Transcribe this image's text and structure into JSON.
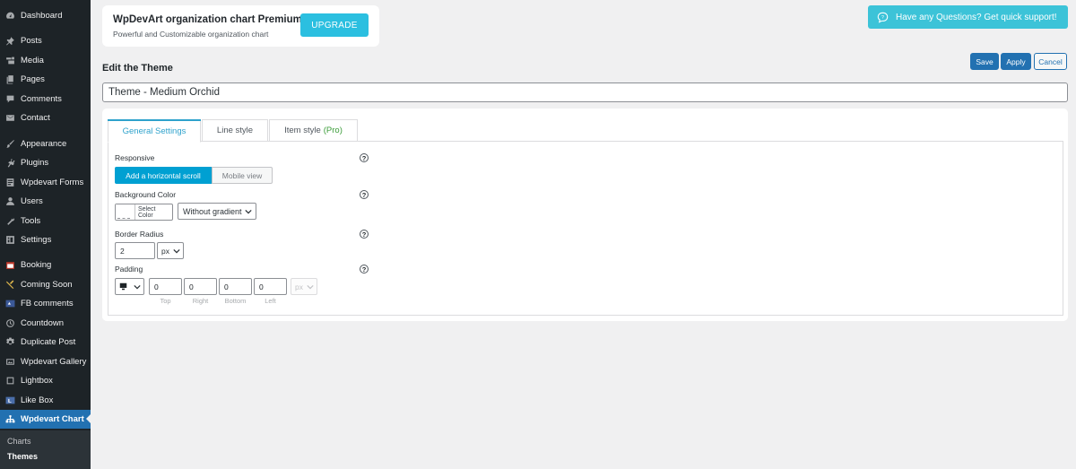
{
  "sidebar": {
    "items": [
      {
        "label": "Dashboard",
        "icon": "dashboard-icon"
      },
      {
        "label": "Posts",
        "icon": "pin-icon"
      },
      {
        "label": "Media",
        "icon": "media-icon"
      },
      {
        "label": "Pages",
        "icon": "pages-icon"
      },
      {
        "label": "Comments",
        "icon": "comment-icon"
      },
      {
        "label": "Contact",
        "icon": "mail-icon"
      },
      {
        "label": "Appearance",
        "icon": "brush-icon"
      },
      {
        "label": "Plugins",
        "icon": "plugin-icon"
      },
      {
        "label": "Wpdevart Forms",
        "icon": "form-icon"
      },
      {
        "label": "Users",
        "icon": "users-icon"
      },
      {
        "label": "Tools",
        "icon": "wrench-icon"
      },
      {
        "label": "Settings",
        "icon": "settings-icon"
      },
      {
        "label": "Booking",
        "icon": "calendar-icon"
      },
      {
        "label": "Coming Soon",
        "icon": "tools-icon"
      },
      {
        "label": "FB comments",
        "icon": "fb-comments-icon"
      },
      {
        "label": "Countdown",
        "icon": "clock-icon"
      },
      {
        "label": "Duplicate Post",
        "icon": "gear-icon"
      },
      {
        "label": "Wpdevart Gallery",
        "icon": "gallery-icon"
      },
      {
        "label": "Lightbox",
        "icon": "lightbox-icon"
      },
      {
        "label": "Like Box",
        "icon": "likebox-icon"
      },
      {
        "label": "Wpdevart Chart",
        "icon": "org-chart-icon"
      }
    ],
    "submenu": [
      "Charts",
      "Themes"
    ]
  },
  "premium": {
    "title": "WpDevArt organization chart Premium",
    "subtitle": "Powerful and Customizable organization chart",
    "button": "UPGRADE"
  },
  "support": {
    "label": "Have any Questions? Get quick support!"
  },
  "page": {
    "title": "Edit the Theme"
  },
  "actions": {
    "save": "Save",
    "apply": "Apply",
    "cancel": "Cancel"
  },
  "theme_name": "Theme - Medium Orchid",
  "tabs": {
    "general": "General Settings",
    "line": "Line style",
    "item": "Item style",
    "item_badge": "(Pro)"
  },
  "settings": {
    "responsive": {
      "label": "Responsive",
      "options": [
        "Add a horizontal scroll",
        "Mobile view"
      ],
      "selected": "Add a horizontal scroll"
    },
    "background": {
      "label": "Background Color",
      "color_button": "Select Color",
      "gradient": "Without gradient"
    },
    "border_radius": {
      "label": "Border Radius",
      "value": "2",
      "unit": "px"
    },
    "padding": {
      "label": "Padding",
      "values": [
        "0",
        "0",
        "0",
        "0"
      ],
      "sides": [
        "Top",
        "Right",
        "Bottom",
        "Left"
      ],
      "unit": "px"
    },
    "help": "?"
  },
  "colors": {
    "sidebar_bg": "#1d2327",
    "active_menu": "#2271b1",
    "primary_button": "#2271b1",
    "upgrade": "#2bbfe0",
    "support": "#3cc3d8",
    "toggle_active": "#00a0d2",
    "pro_badge": "#3a9c38"
  }
}
